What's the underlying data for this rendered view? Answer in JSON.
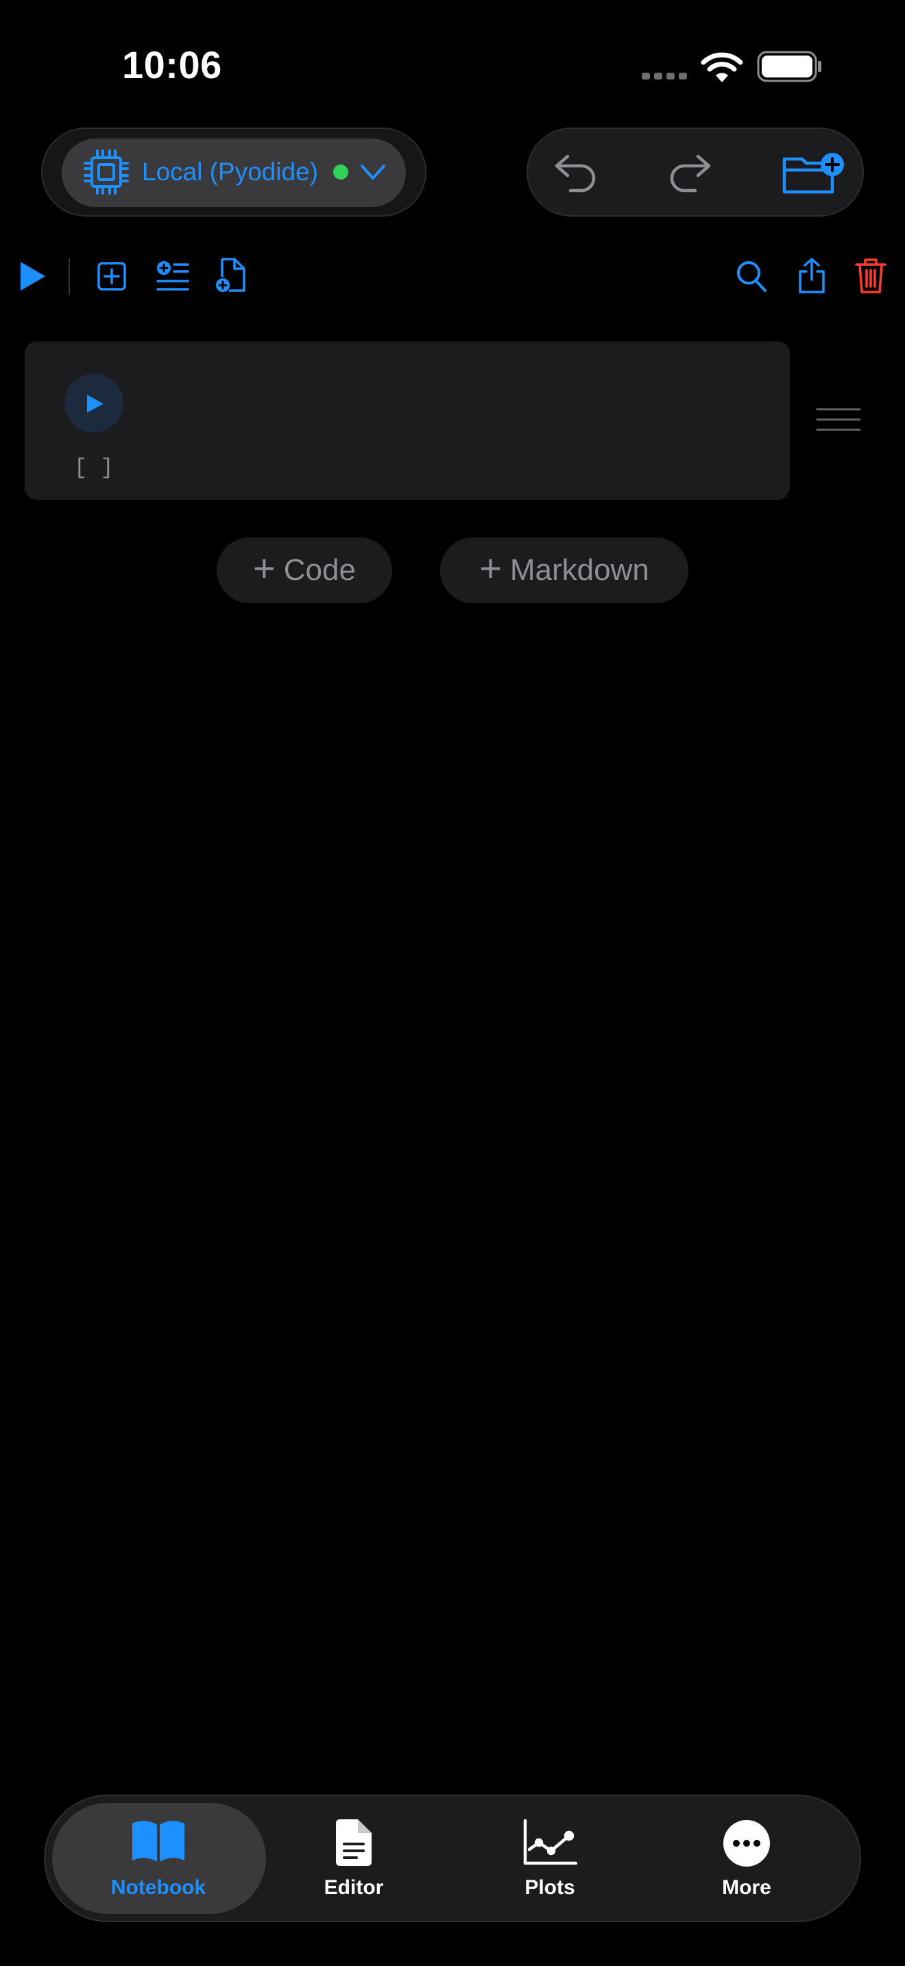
{
  "status_bar": {
    "time": "10:06"
  },
  "kernel": {
    "label": "Local (Pyodide)",
    "status_color": "#30d158",
    "icon": "cpu-chip-icon"
  },
  "history": {
    "undo_icon": "undo-icon",
    "redo_icon": "redo-icon",
    "new_folder_icon": "folder-add-icon"
  },
  "toolbar": {
    "left_icons": [
      "play-icon",
      "add-cell-icon",
      "add-text-cell-icon",
      "new-file-icon"
    ],
    "right_icons": [
      "search-icon",
      "share-icon",
      "trash-icon"
    ]
  },
  "cell": {
    "execution_count": "[ ]",
    "code": ""
  },
  "add_buttons": {
    "plus": "+",
    "code": "Code",
    "markdown": "Markdown"
  },
  "tabs": [
    {
      "label": "Notebook",
      "icon": "book-icon",
      "active": true
    },
    {
      "label": "Editor",
      "icon": "document-icon",
      "active": false
    },
    {
      "label": "Plots",
      "icon": "chart-icon",
      "active": false
    },
    {
      "label": "More",
      "icon": "ellipsis-icon",
      "active": false
    }
  ],
  "colors": {
    "accent": "#1e8fff",
    "danger": "#ff3b30",
    "background": "#000000",
    "surface": "#1c1c1e"
  }
}
